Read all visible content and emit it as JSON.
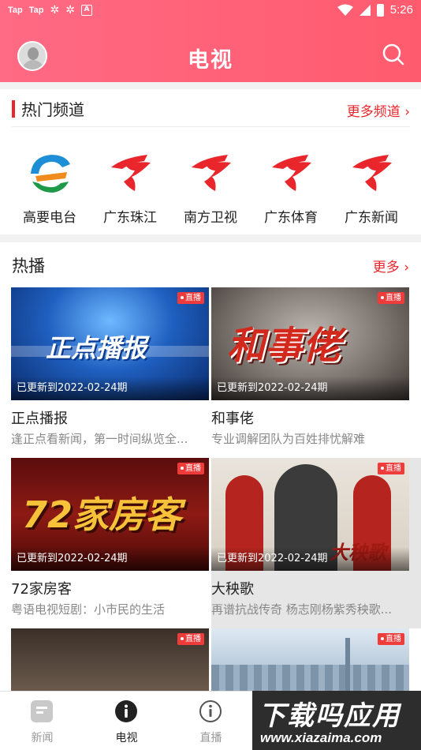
{
  "status_bar": {
    "left_items": [
      "Tap",
      "Tap"
    ],
    "time": "5:26"
  },
  "header": {
    "title": "电视"
  },
  "channels_section": {
    "title": "热门频道",
    "more_label": "更多频道 ›",
    "channels": [
      {
        "name": "高要电台",
        "icon": "gaoyao-logo"
      },
      {
        "name": "广东珠江",
        "icon": "gdtv-logo"
      },
      {
        "name": "南方卫视",
        "icon": "gdtv-logo"
      },
      {
        "name": "广东体育",
        "icon": "gdtv-logo"
      },
      {
        "name": "广东新闻",
        "icon": "gdtv-logo"
      }
    ]
  },
  "hot_section": {
    "title": "热播",
    "more_label": "更多 ›",
    "live_label": "直播",
    "items": [
      {
        "thumb_text": "正点播报",
        "updated": "已更新到2022-02-24期",
        "name": "正点播报",
        "desc": "逢正点看新闻，第一时间纵览全..."
      },
      {
        "thumb_text": "和事佬",
        "updated": "已更新到2022-02-24期",
        "name": "和事佬",
        "desc": "专业调解团队为百姓排忧解难"
      },
      {
        "thumb_text": "72家房客",
        "updated": "已更新到2022-02-24期",
        "name": "72家房客",
        "desc": "粤语电视短剧：小市民的生活"
      },
      {
        "thumb_text": "大秧歌",
        "updated": "已更新到2022-02-24期",
        "name": "大秧歌",
        "desc": "再谱抗战传奇 杨志刚杨紫秀秧歌..."
      },
      {
        "thumb_text": "",
        "updated": "",
        "name": "",
        "desc": ""
      },
      {
        "thumb_text": "",
        "updated": "",
        "name": "",
        "desc": ""
      }
    ]
  },
  "bottom_nav": {
    "items": [
      {
        "label": "新闻",
        "icon": "news-icon"
      },
      {
        "label": "电视",
        "icon": "tv-info-icon"
      },
      {
        "label": "直播",
        "icon": "live-info-icon"
      }
    ]
  },
  "watermark": {
    "text": "下载吗应用",
    "url": "www.xiazaima.com"
  },
  "colors": {
    "accent": "#e8262b",
    "header_gradient_start": "#ff6a84",
    "header_gradient_end": "#ff5b6e"
  }
}
